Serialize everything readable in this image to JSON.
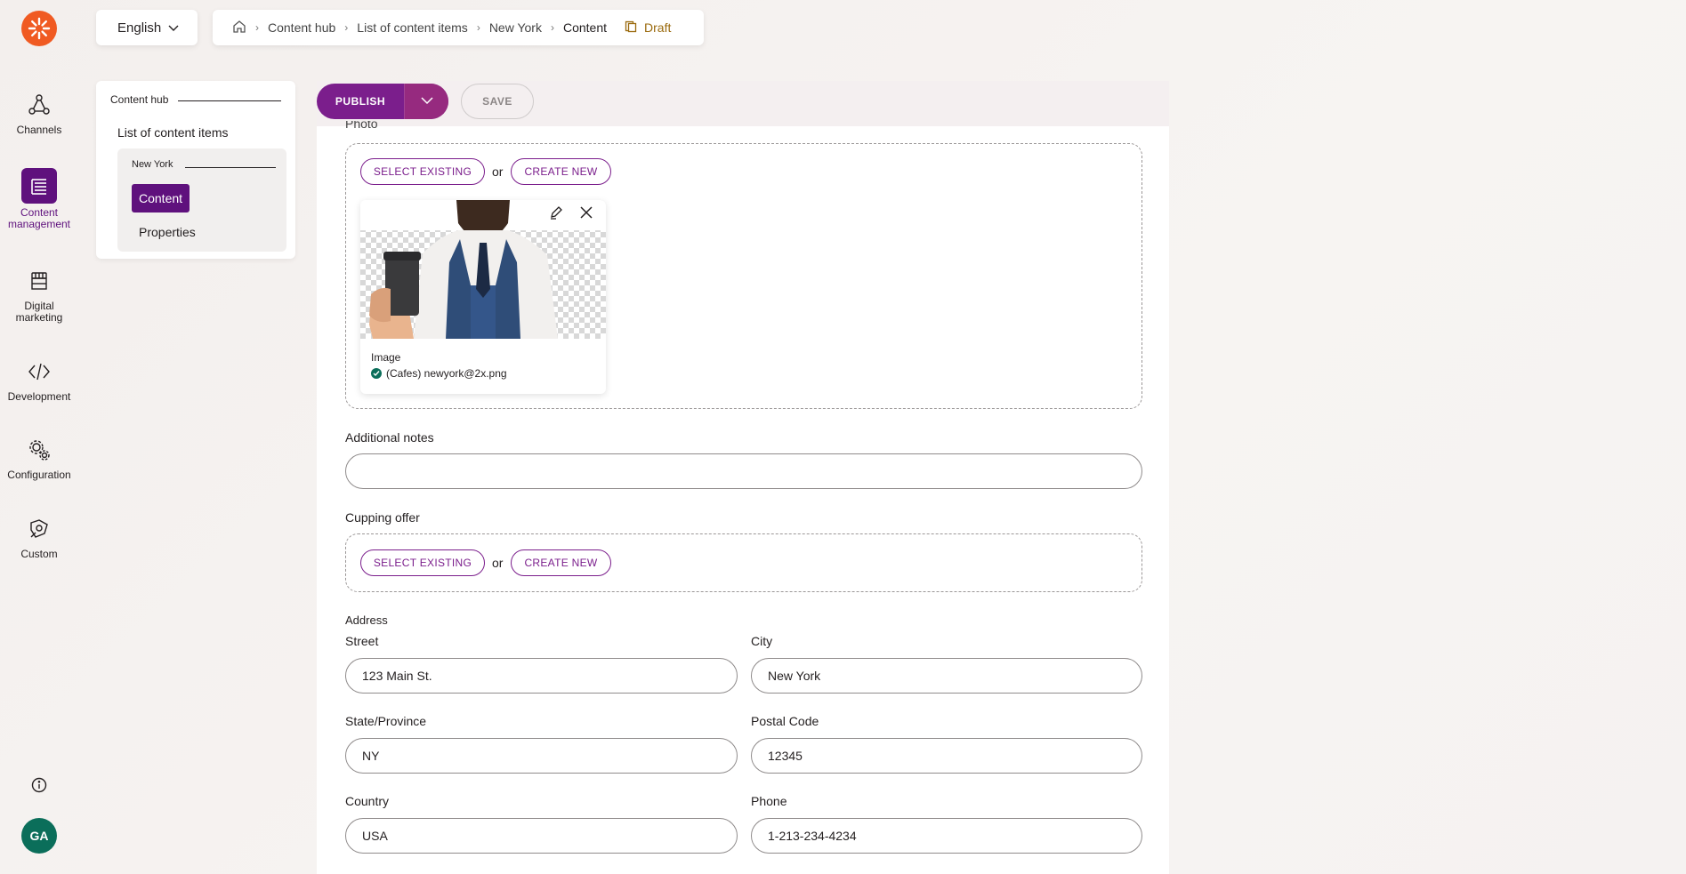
{
  "rail": {
    "items": [
      {
        "label": "Channels",
        "icon": "channels-icon"
      },
      {
        "label": "Content management",
        "icon": "content-management-icon"
      },
      {
        "label": "Digital marketing",
        "icon": "digital-marketing-icon"
      },
      {
        "label": "Development",
        "icon": "code-icon"
      },
      {
        "label": "Configuration",
        "icon": "gears-icon"
      },
      {
        "label": "Custom",
        "icon": "custom-icon"
      }
    ],
    "avatar_initials": "GA"
  },
  "topbar": {
    "language": "English",
    "breadcrumb": [
      "Content hub",
      "List of content items",
      "New York",
      "Content"
    ],
    "status": "Draft"
  },
  "tree": {
    "hub": "Content hub",
    "list": "List of content items",
    "item": "New York",
    "tabs": [
      "Content",
      "Properties"
    ]
  },
  "toolbar": {
    "publish_label": "PUBLISH",
    "save_label": "SAVE"
  },
  "form": {
    "photo": {
      "label": "Photo",
      "select_existing": "SELECT EXISTING",
      "or": "or",
      "create_new": "CREATE NEW",
      "asset_type": "Image",
      "asset_name": "(Cafes) newyork@2x.png"
    },
    "additional_notes": {
      "label": "Additional notes",
      "value": ""
    },
    "cupping_offer": {
      "label": "Cupping offer",
      "select_existing": "SELECT EXISTING",
      "or": "or",
      "create_new": "CREATE NEW"
    },
    "address": {
      "title": "Address",
      "street_label": "Street",
      "street": "123 Main St.",
      "city_label": "City",
      "city": "New York",
      "state_label": "State/Province",
      "state": "NY",
      "postal_label": "Postal Code",
      "postal": "12345",
      "country_label": "Country",
      "country": "USA",
      "phone_label": "Phone",
      "phone": "1-213-234-4234"
    }
  },
  "colors": {
    "brand_purple": "#5f117d",
    "publish": "#7b1e8c",
    "logo_orange": "#f05a22",
    "avatar_green": "#0b6e5a",
    "draft_gold": "#9a6a0d"
  }
}
